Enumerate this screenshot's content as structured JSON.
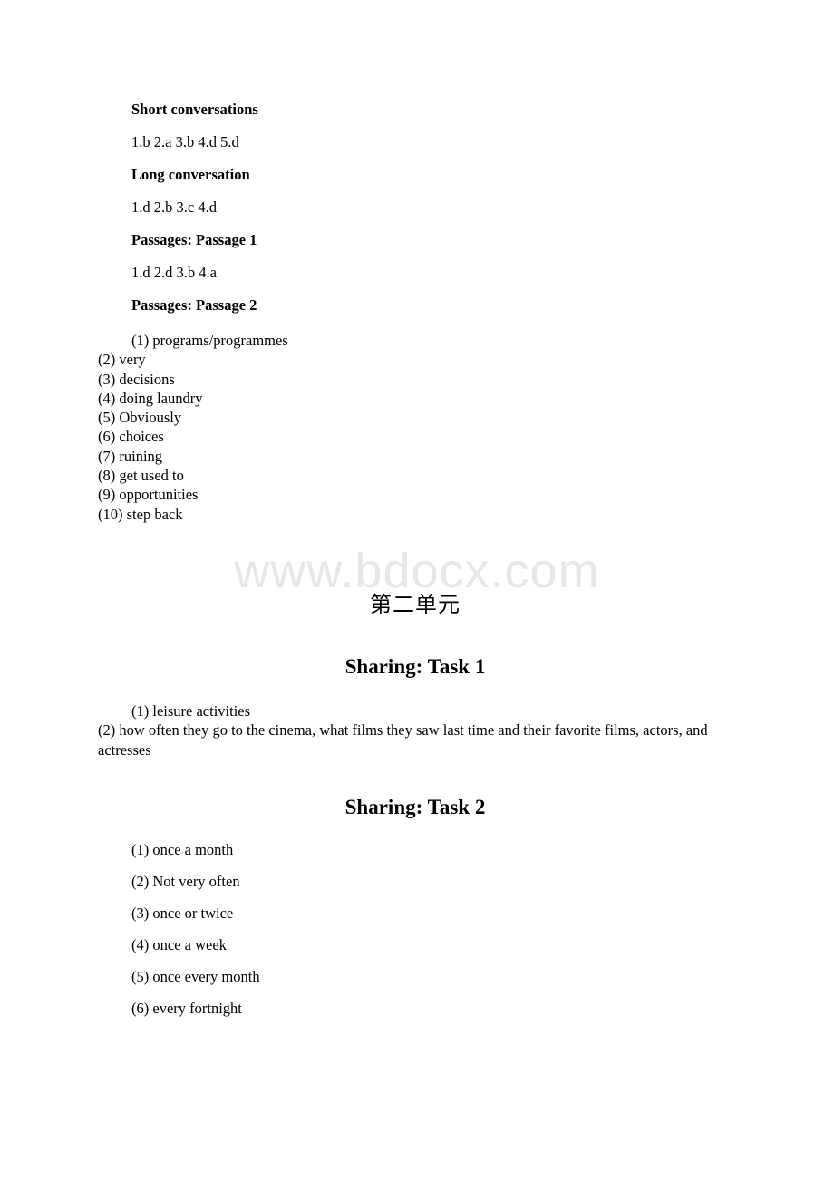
{
  "document": {
    "watermark": "www.bdocx.com",
    "unit_title": "第二单元"
  },
  "listening": {
    "short_conversations": {
      "heading": "Short conversations",
      "answers": "1.b 2.a 3.b 4.d 5.d"
    },
    "long_conversation": {
      "heading": "Long conversation",
      "answers": "1.d 2.b 3.c 4.d"
    },
    "passage_1": {
      "heading": "Passages: Passage 1",
      "answers": "1.d 2.d 3.b 4.a"
    },
    "passage_2": {
      "heading": "Passages: Passage 2",
      "items": [
        "(1) programs/programmes",
        "(2) very",
        "(3) decisions",
        "(4) doing laundry",
        "(5) Obviously",
        "(6) choices",
        "(7) ruining",
        "(8) get used to",
        "(9) opportunities",
        "(10) step back"
      ]
    }
  },
  "sharing_task_1": {
    "heading": "Sharing: Task 1",
    "items": [
      "(1) leisure activities",
      "(2) how often they go to the cinema, what films they saw last time and their favorite films, actors, and actresses"
    ]
  },
  "sharing_task_2": {
    "heading": "Sharing: Task 2",
    "items": [
      "(1) once a month",
      "(2) Not very often",
      "(3) once or twice",
      "(4) once a week",
      "(5) once every month",
      "(6) every fortnight"
    ]
  }
}
